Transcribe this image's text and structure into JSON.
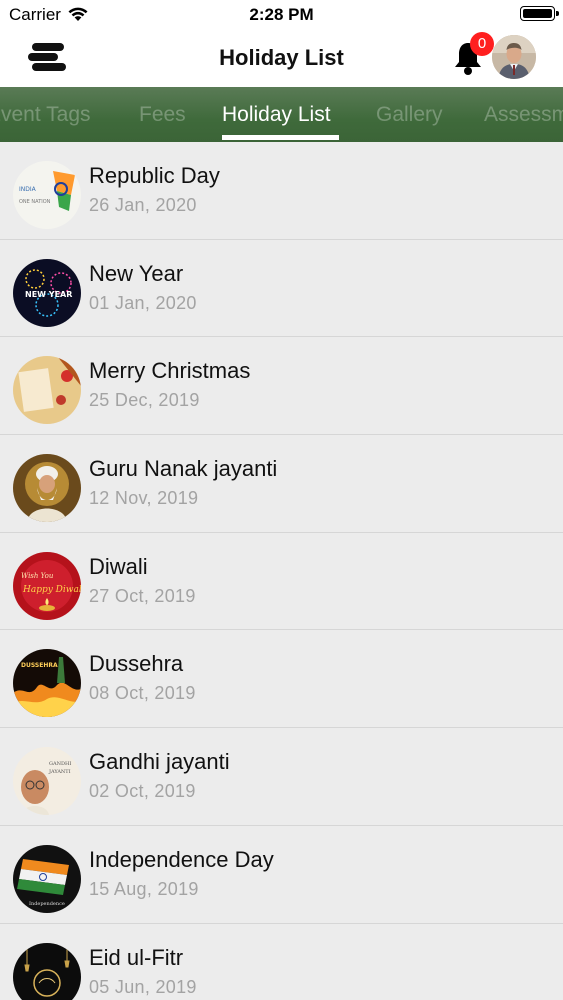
{
  "status_bar": {
    "carrier": "Carrier",
    "time": "2:28 PM"
  },
  "nav": {
    "title": "Holiday List",
    "notification_count": "0"
  },
  "tabs": [
    {
      "label": "Event Tags"
    },
    {
      "label": "Fees"
    },
    {
      "label": "Holiday List",
      "active": true
    },
    {
      "label": "Gallery"
    },
    {
      "label": "Assessment"
    }
  ],
  "holidays": [
    {
      "name": "Republic Day",
      "date": "26 Jan, 2020",
      "icon": "republic-day-image"
    },
    {
      "name": "New Year",
      "date": "01 Jan, 2020",
      "icon": "new-year-image"
    },
    {
      "name": "Merry Christmas",
      "date": "25 Dec, 2019",
      "icon": "christmas-image"
    },
    {
      "name": "Guru Nanak jayanti",
      "date": "12 Nov, 2019",
      "icon": "guru-nanak-image"
    },
    {
      "name": "Diwali",
      "date": "27 Oct, 2019",
      "icon": "diwali-image"
    },
    {
      "name": "Dussehra",
      "date": "08 Oct, 2019",
      "icon": "dussehra-image"
    },
    {
      "name": "Gandhi jayanti",
      "date": "02 Oct, 2019",
      "icon": "gandhi-image"
    },
    {
      "name": "Independence Day",
      "date": "15 Aug, 2019",
      "icon": "independence-day-image"
    },
    {
      "name": "Eid ul-Fitr",
      "date": "05 Jun, 2019",
      "icon": "eid-image"
    }
  ],
  "colors": {
    "tab_bar": "#3f6a3b",
    "badge": "#ff1f1f",
    "row_bg": "#ececec",
    "date_text": "#a3a3a3"
  }
}
